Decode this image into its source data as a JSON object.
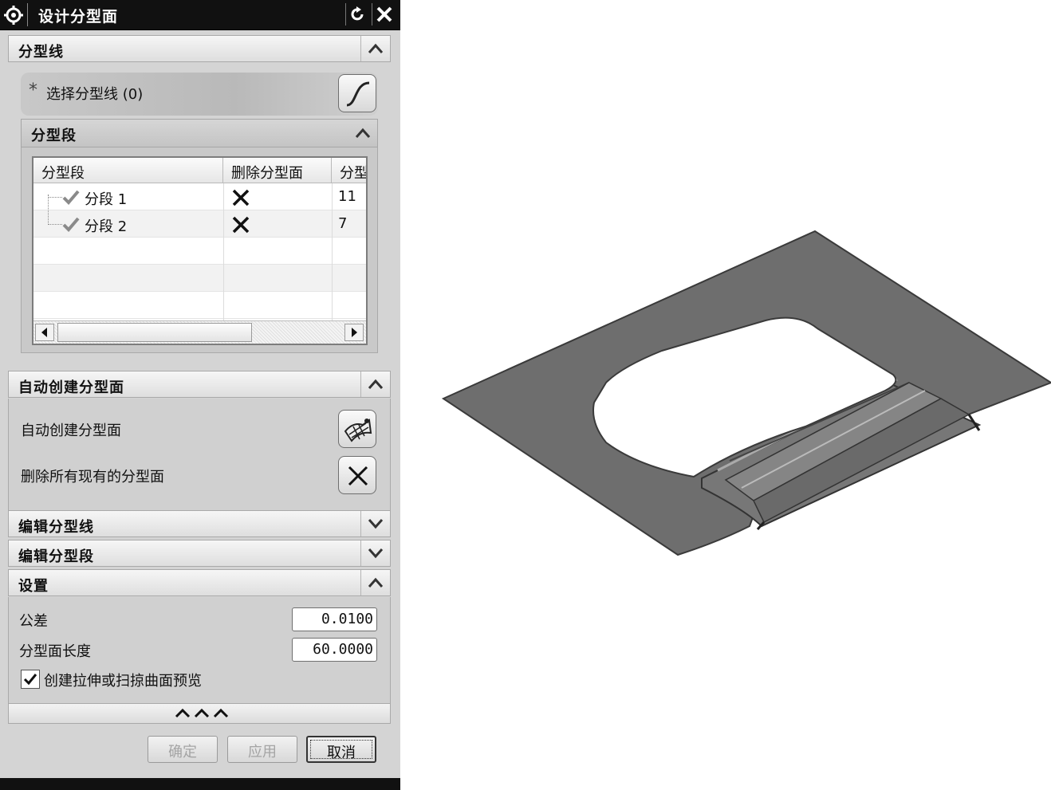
{
  "dialog": {
    "title": "设计分型面",
    "title_icon": "gear-icon",
    "reset_icon": "reset-icon",
    "close_icon": "close-icon"
  },
  "parting_line": {
    "header": "分型线",
    "select_label": "选择分型线 (0)",
    "select_required_mark": "*",
    "curve_icon": "curve-icon"
  },
  "segments": {
    "header": "分型段",
    "columns": [
      "分型段",
      "删除分型面",
      "分型"
    ],
    "rows": [
      {
        "name": "分段 1",
        "delete_icon": "x-mark-icon",
        "value": "11"
      },
      {
        "name": "分段 2",
        "delete_icon": "x-mark-icon",
        "value": "7"
      }
    ]
  },
  "auto_create": {
    "header": "自动创建分型面",
    "create_label": "自动创建分型面",
    "delete_label": "删除所有现有的分型面",
    "create_icon": "mesh-surface-icon",
    "delete_icon": "delete-x-icon"
  },
  "edit_parting_line": {
    "header": "编辑分型线"
  },
  "edit_segments": {
    "header": "编辑分型段"
  },
  "settings": {
    "header": "设置",
    "tolerance_label": "公差",
    "tolerance_value": "0.0100",
    "length_label": "分型面长度",
    "length_value": "60.0000",
    "preview_label": "创建拉伸或扫掠曲面预览",
    "preview_checked": true
  },
  "footer": {
    "more_icon": "expand-more-icon",
    "ok": "确定",
    "apply": "应用",
    "cancel": "取消"
  },
  "colors": {
    "titlebar": "#111111",
    "dialog_bg": "#d4d4d4",
    "model_surface": "#6e6e6e",
    "model_edge": "#3a3a3a"
  }
}
